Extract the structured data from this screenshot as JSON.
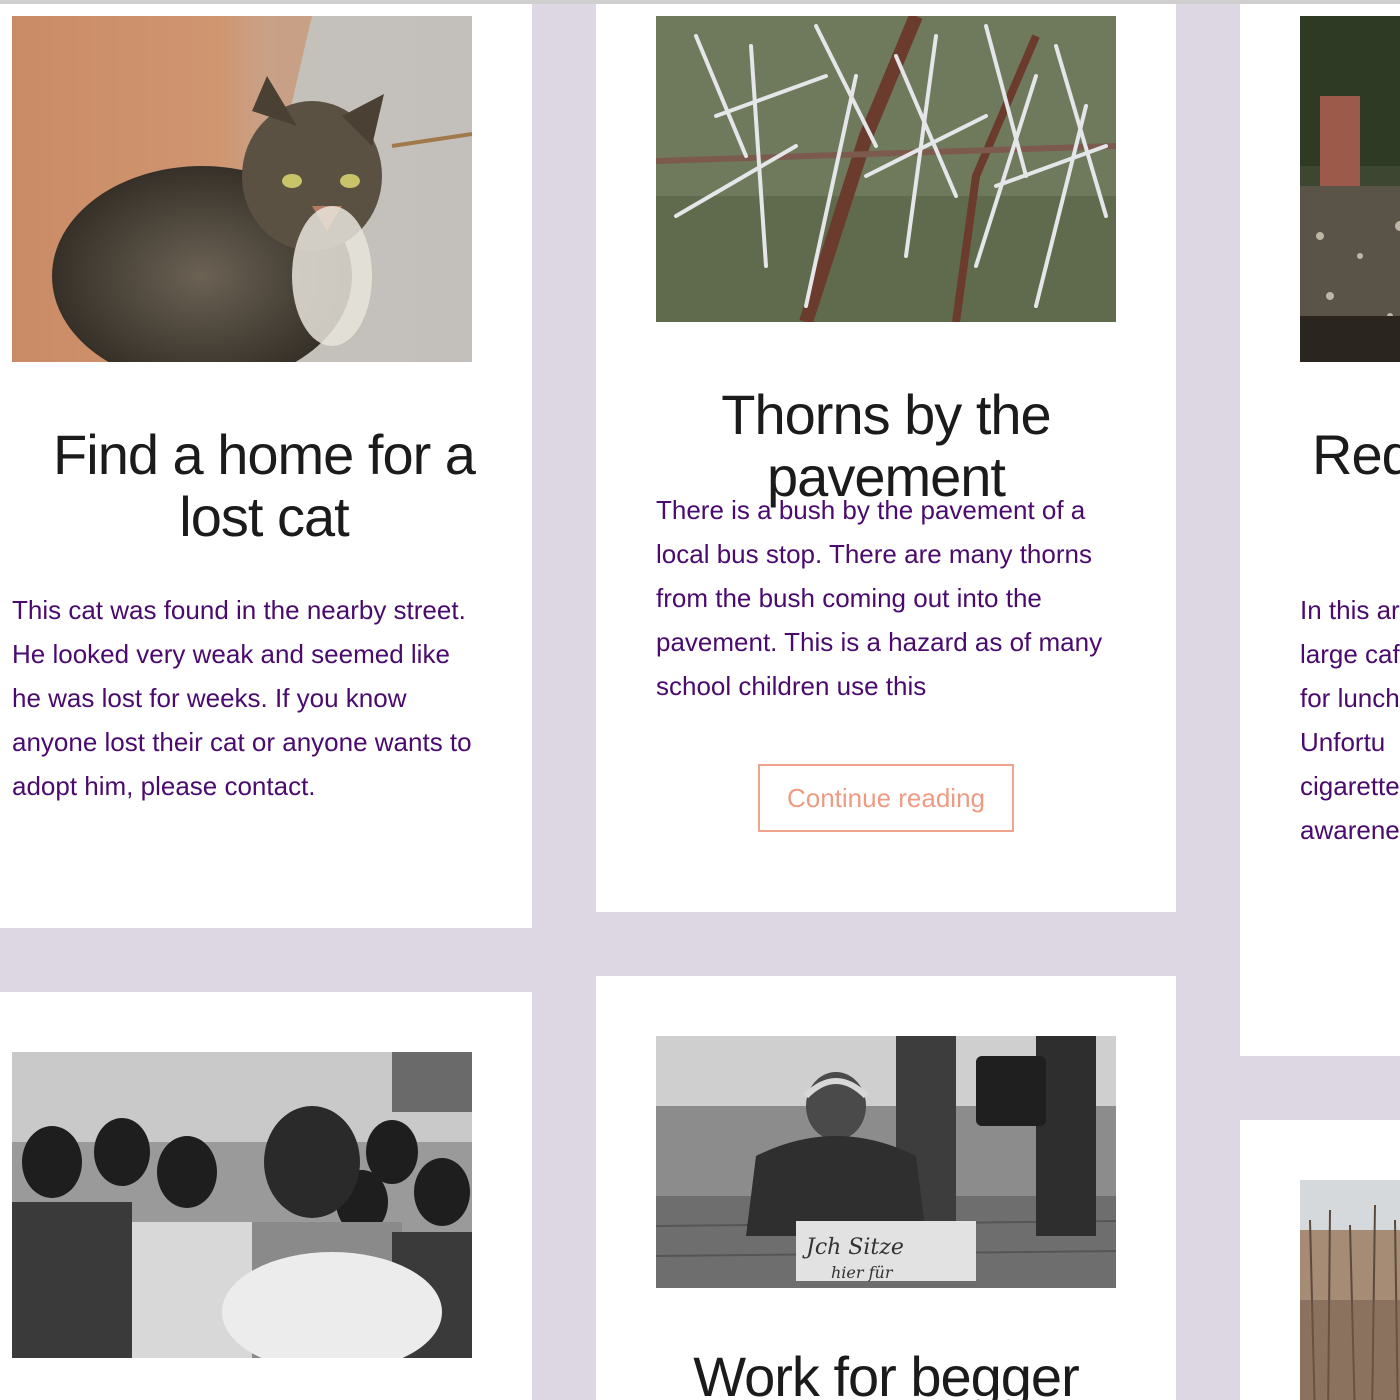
{
  "cards": [
    {
      "title": "Find a home for a lost cat",
      "excerpt": "This cat was found in the nearby street. He looked very weak and seemed like he was lost for weeks. If you know anyone lost their cat or anyone wants to adopt him, please contact.",
      "image_icon": "cat-photo"
    },
    {
      "title": "Thorns by the pavement",
      "excerpt": "There is a bush by the pavement of a local bus stop. There are many thorns from the bush coming out into the pavement. This is a hazard as of many school children use this",
      "button_label": "Continue reading",
      "image_icon": "thorn-bush-photo"
    },
    {
      "title": "Requ",
      "excerpt_lines": [
        "In this ar",
        "large caf",
        "for lunch",
        "Unfortu",
        "cigarette",
        "awarene"
      ],
      "image_icon": "park-ground-photo"
    },
    {
      "title": "",
      "image_icon": "children-photo"
    },
    {
      "title": "Work for begger",
      "image_icon": "man-sitting-sign-photo",
      "sign_text": "Jch Sitze hier für"
    },
    {
      "title": "",
      "image_icon": "winter-trees-photo"
    }
  ],
  "colors": {
    "background": "#ddd7e3",
    "card": "#ffffff",
    "excerpt_text": "#4a0a6e",
    "title_text": "#1b1b1b",
    "button_accent": "#ee9b82"
  }
}
